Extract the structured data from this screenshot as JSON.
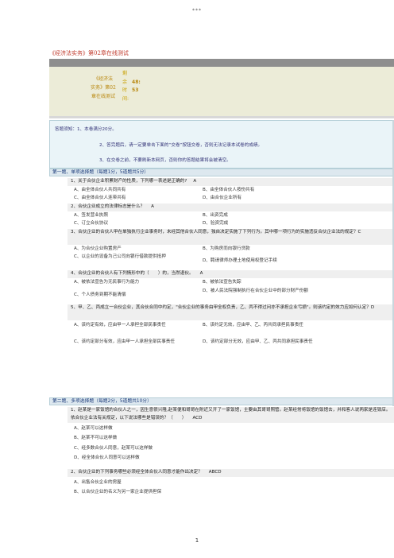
{
  "header": "***",
  "doc_title": "《经济法实务》第02章在线测试",
  "info": {
    "name_lines": [
      "《经济法",
      "实务》第02",
      "章在线测试"
    ],
    "remain_chars": [
      "剩",
      "余",
      "时",
      "间:"
    ],
    "minutes": "48:",
    "seconds": "53"
  },
  "notes": [
    "答题须知：1、本卷满分20分。",
    "2、答完题后，请一定要单击下面的“交卷”按钮交卷，否则无法记录本试卷的成绩。",
    "3、在交卷之前，不要刷新本网页，否则你的答题结果将会被清空。"
  ],
  "section1": "第一题、单项选择题（每题1分，5道题共5分）",
  "q1": {
    "text": "1、关于合伙企业积累财产的性质，下列哪一表述是正确的?",
    "answer": "A",
    "a": "A、由全体合伙人共同共有",
    "b": "B、由全体合伙人按份共有",
    "c": "C、由全体合伙人连带共有",
    "d": "D、由合伙企业所有"
  },
  "q2": {
    "text": "2、合伙企业成立的法律标志是什么？",
    "answer": "A",
    "a": "A、签发营业执照",
    "b": "B、出资完成",
    "c": "C、订立合伙协议",
    "d": "D、验资完成"
  },
  "q3": {
    "text": "3、合伙企业的合伙人甲在单独执行企业事务时，未经其他合伙人同意，独自决定实施了下列行为。其中哪一项行为的实施违反合伙企业法的规定？C",
    "a": "A、为合伙企业购置房产",
    "b": "B、为购房而向银行贷款",
    "c": "C、以企业的设备为己公司向银行借款提供抵押",
    "d": "D、聘请律师办理土地使用权登记手续"
  },
  "q4": {
    "text": "4、合伙企业的合伙人有下列情形中的（　　）的，当然退伙。",
    "answer": "A",
    "a": "A、被依法宣告为无民事行为能力",
    "b": "B、被依法宣告失踪",
    "c": "C、个人债务到期不能清偿",
    "d": "D、被人民法院强制执行在合伙企业中的部分财产份额"
  },
  "q5": {
    "text": "5、甲、乙、丙成立一合伙企业，其合伙合同中约定，\"合伙企业的事务由甲全权负责，乙、丙不得过问亦不承担企业亏损\"。则该约定的效力应如何认定？D",
    "a": "A、该约定有效，应由甲一人承担全部民事责任",
    "b": "B、该约定无效，应由甲、乙、丙共同承担民事责任",
    "c": "C、该约定部分有效，应由甲一人承担全部民事责任",
    "d": "D、该约定部分无效，应由甲、乙、丙共同承担民事责任"
  },
  "section2": "第二题、多项选择题（每题2分，5道题共10分）",
  "q6": {
    "text": "1、赵某是一家饭馆的合伙人之一，因生意很兴隆,赵某便和哥哥在附近又开了一家饭馆，主要由其哥哥照管。赵某经常将饭馆的饭馆去，并和客人说两家是连锁店。依合伙企业法有关规定，以下说法哪些是错误的？（　　）",
    "answer": "ACD",
    "a": "A、赵某可以这样做",
    "b": "B、赵某不可以这样做",
    "c": "C、经多数合伙人同意，赵某可以这样做",
    "d": "D、经全体合伙人同意可以这样做"
  },
  "q7": {
    "text": "2、合伙企业的下列事务哪些必须经全体合伙人同意才能作出决定？",
    "answer": "ABCD",
    "a": "A、出售合伙企业的房屋",
    "b": "B、以合伙企业的名义为另一家企业提供担保"
  },
  "page_number": "1"
}
